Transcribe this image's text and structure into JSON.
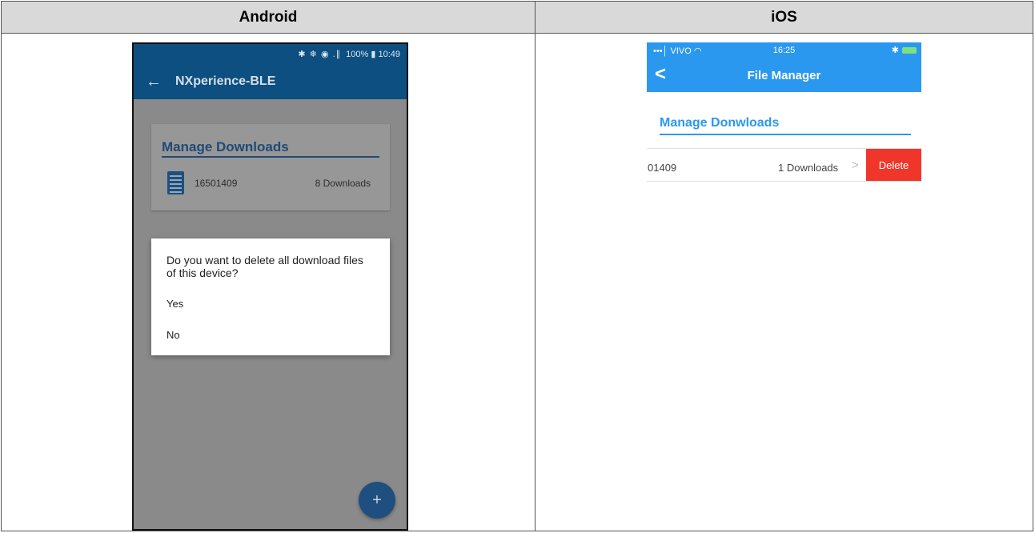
{
  "table": {
    "headers": [
      "Android",
      "iOS"
    ]
  },
  "android": {
    "status_icons": "✱ ❄ ◉ .∥",
    "status_text": "100% ▮ 10:49",
    "back_icon": "←",
    "title": "NXperience-BLE",
    "card": {
      "title": "Manage Downloads",
      "file_name": "16501409",
      "file_count": "8 Downloads"
    },
    "dialog": {
      "message": "Do you want to delete all download files of this device?",
      "yes": "Yes",
      "no": "No"
    },
    "fab_icon": "+"
  },
  "ios": {
    "carrier": "•••│ VIVO ◠",
    "time": "16:25",
    "bluetooth_icon": "✱",
    "back_icon": "<",
    "title": "File Manager",
    "section_title": "Manage Donwloads",
    "row": {
      "id": "01409",
      "count": "1 Downloads",
      "chevron": ">",
      "delete_label": "Delete"
    }
  },
  "colors": {
    "android_bar": "#0c4f80",
    "android_overlay": "#8a8a8a",
    "ios_accent": "#2b98ef",
    "ios_delete": "#f0362b",
    "header_bg": "#d9d9d9"
  }
}
